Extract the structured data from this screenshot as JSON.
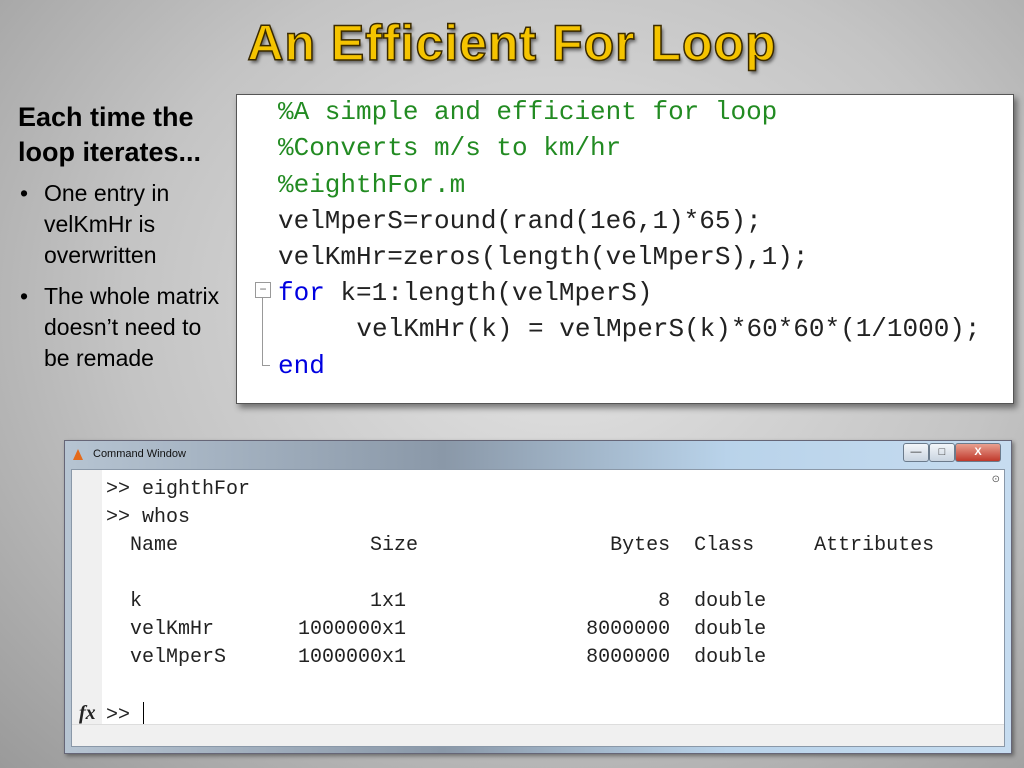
{
  "slide": {
    "title": "An Efficient For Loop",
    "heading": "Each time the loop iterates...",
    "bullets": [
      "One entry in velKmHr is overwritten",
      "The whole matrix doesn’t need to be remade"
    ]
  },
  "code": {
    "lines": [
      "%A simple and efficient for loop",
      "%Converts m/s to km/hr",
      "%eighthFor.m",
      "velMperS=round(rand(1e6,1)*65);",
      "velKmHr=zeros(length(velMperS),1);",
      "for",
      " k=1:length(velMperS)",
      "    velKmHr(k) = velMperS(k)*60*60*(1/1000);",
      "end"
    ]
  },
  "command_window": {
    "title": "Command Window",
    "lines": [
      ">> eighthFor",
      ">> whos",
      "  Name                Size                Bytes  Class     Attributes",
      "",
      "  k                   1x1                     8  double",
      "  velKmHr       1000000x1               8000000  double",
      "  velMperS      1000000x1               8000000  double"
    ],
    "prompt": ">>",
    "fx": "fx",
    "min": "—",
    "max": "□",
    "close": "X"
  }
}
